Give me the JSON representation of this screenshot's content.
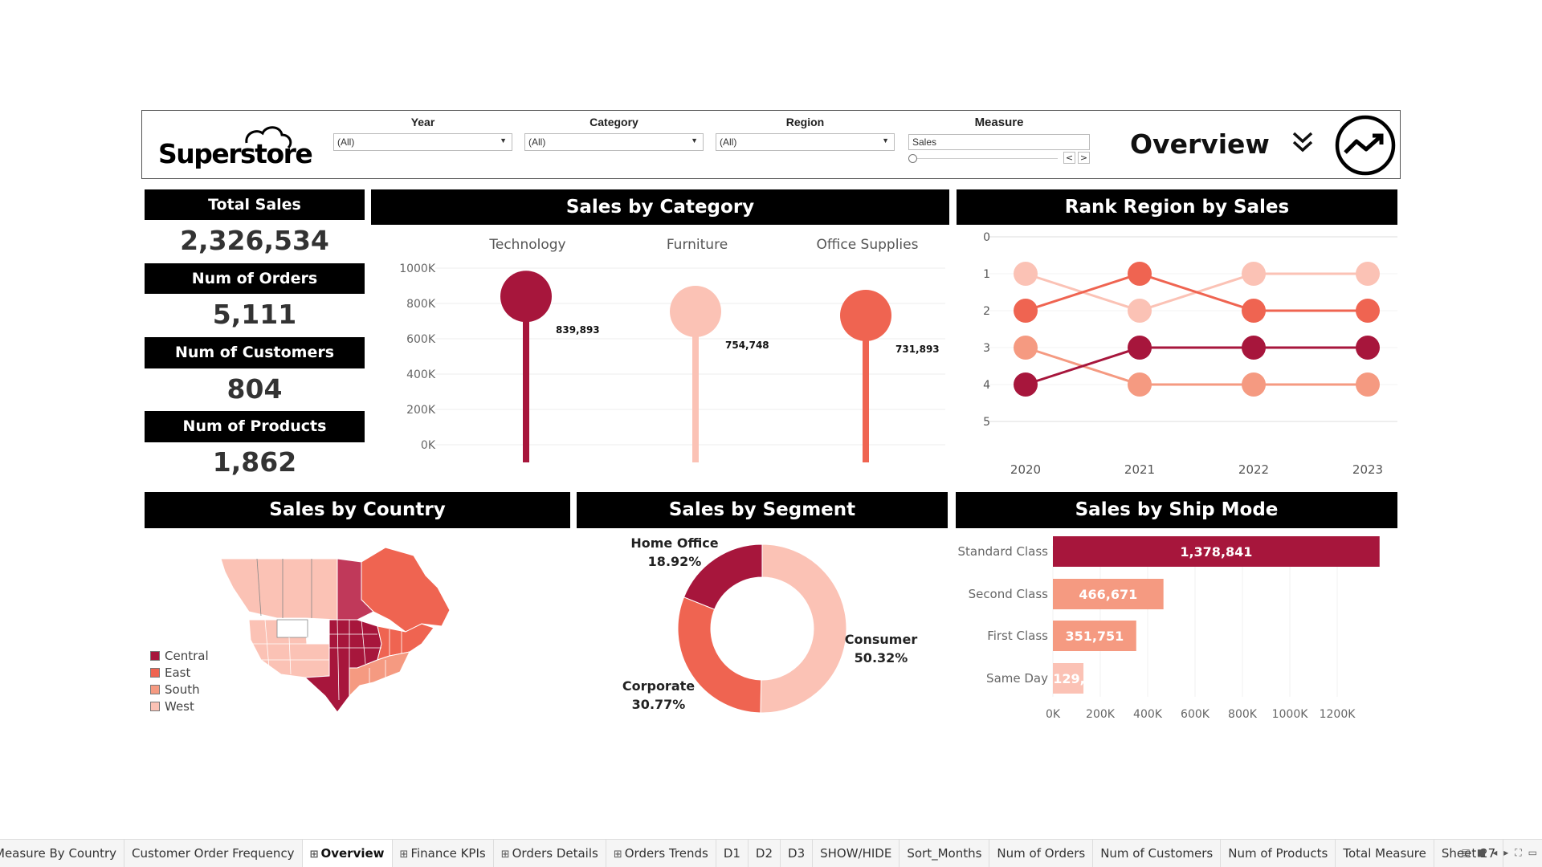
{
  "header": {
    "logo": "Superstore",
    "filters": [
      {
        "label": "Year",
        "value": "(All)"
      },
      {
        "label": "Category",
        "value": "(All)"
      },
      {
        "label": "Region",
        "value": "(All)"
      }
    ],
    "measure": {
      "label": "Measure",
      "value": "Sales"
    },
    "page_title": "Overview"
  },
  "kpis": [
    {
      "label": "Total Sales",
      "value": "2,326,534"
    },
    {
      "label": "Num of Orders",
      "value": "5,111"
    },
    {
      "label": "Num of Customers",
      "value": "804"
    },
    {
      "label": "Num of Products",
      "value": "1,862"
    }
  ],
  "titles": {
    "category": "Sales by Category",
    "rank": "Rank Region by Sales",
    "country": "Sales by Country",
    "segment": "Sales by Segment",
    "shipmode": "Sales by Ship Mode"
  },
  "colors": {
    "Central": "#a7163c",
    "East": "#ef6451",
    "South": "#f59a81",
    "West": "#fbc2b5"
  },
  "chart_data": [
    {
      "type": "bar",
      "title": "Sales by Category",
      "categories": [
        "Technology",
        "Furniture",
        "Office Supplies"
      ],
      "values": [
        839893,
        754748,
        731893
      ],
      "labels": [
        "839,893",
        "754,748",
        "731,893"
      ],
      "colors": [
        "#a7163c",
        "#fbc2b5",
        "#ef6451"
      ],
      "ylim": [
        0,
        1000000
      ],
      "yticks": [
        "0K",
        "200K",
        "400K",
        "600K",
        "800K",
        "1000K"
      ]
    },
    {
      "type": "line",
      "title": "Rank Region by Sales",
      "x": [
        "2020",
        "2021",
        "2022",
        "2023"
      ],
      "ylim": [
        0,
        5
      ],
      "yticks": [
        "0",
        "1",
        "2",
        "3",
        "4",
        "5"
      ],
      "series": [
        {
          "region": "West",
          "values": [
            1,
            2,
            1,
            1
          ],
          "color": "#fbc2b5"
        },
        {
          "region": "East",
          "values": [
            2,
            1,
            2,
            2
          ],
          "color": "#ef6451"
        },
        {
          "region": "South",
          "values": [
            3,
            4,
            4,
            4
          ],
          "color": "#f59a81"
        },
        {
          "region": "Central",
          "values": [
            4,
            3,
            3,
            3
          ],
          "color": "#a7163c"
        }
      ]
    },
    {
      "type": "pie",
      "title": "Sales by Segment",
      "slices": [
        {
          "name": "Consumer",
          "pct": "50.32%",
          "value": 50.32,
          "color": "#fbc2b5"
        },
        {
          "name": "Corporate",
          "pct": "30.77%",
          "value": 30.77,
          "color": "#ef6451"
        },
        {
          "name": "Home Office",
          "pct": "18.92%",
          "value": 18.92,
          "color": "#a7163c"
        }
      ]
    },
    {
      "type": "bar",
      "title": "Sales by Ship Mode",
      "categories": [
        "Standard Class",
        "Second Class",
        "First Class",
        "Same Day"
      ],
      "values": [
        1378841,
        466671,
        351751,
        129000
      ],
      "labels": [
        "1,378,841",
        "466,671",
        "351,751",
        "129,"
      ],
      "colors": [
        "#a7163c",
        "#f59a81",
        "#f59a81",
        "#fbc2b5"
      ],
      "xlim": [
        0,
        1400000
      ],
      "xticks": [
        "0K",
        "200K",
        "400K",
        "600K",
        "800K",
        "1000K",
        "1200K"
      ]
    }
  ],
  "map": {
    "legend": [
      "Central",
      "East",
      "South",
      "West"
    ]
  },
  "tabs": [
    {
      "label": "Measure By Country",
      "active": false,
      "icon": false
    },
    {
      "label": "Customer Order Frequency",
      "active": false,
      "icon": false
    },
    {
      "label": "Overview",
      "active": true,
      "icon": true
    },
    {
      "label": "Finance KPIs",
      "active": false,
      "icon": true
    },
    {
      "label": "Orders Details",
      "active": false,
      "icon": true
    },
    {
      "label": "Orders Trends",
      "active": false,
      "icon": true
    },
    {
      "label": "D1",
      "active": false,
      "icon": false
    },
    {
      "label": "D2",
      "active": false,
      "icon": false
    },
    {
      "label": "D3",
      "active": false,
      "icon": false
    },
    {
      "label": "SHOW/HIDE",
      "active": false,
      "icon": false
    },
    {
      "label": "Sort_Months",
      "active": false,
      "icon": false
    },
    {
      "label": "Num of Orders",
      "active": false,
      "icon": false
    },
    {
      "label": "Num of Customers",
      "active": false,
      "icon": false
    },
    {
      "label": "Num of Products",
      "active": false,
      "icon": false
    },
    {
      "label": "Total Measure",
      "active": false,
      "icon": false
    },
    {
      "label": "Sheet 27",
      "active": false,
      "icon": false
    }
  ]
}
